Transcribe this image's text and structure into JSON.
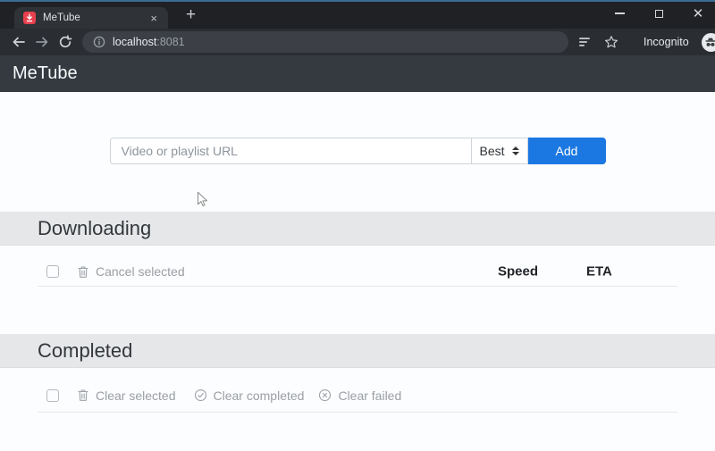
{
  "browser": {
    "tab_title": "MeTube",
    "close_glyph": "×",
    "new_tab_glyph": "+",
    "url": {
      "host": "localhost",
      "port": ":8081"
    },
    "incognito_label": "Incognito"
  },
  "navbar": {
    "brand": "MeTube"
  },
  "add_form": {
    "url_placeholder": "Video or playlist URL",
    "quality_value": "Best",
    "add_button": "Add"
  },
  "downloading_section": {
    "title": "Downloading",
    "cancel_selected_label": "Cancel selected",
    "speed_header": "Speed",
    "eta_header": "ETA"
  },
  "completed_section": {
    "title": "Completed",
    "clear_selected_label": "Clear selected",
    "clear_completed_label": "Clear completed",
    "clear_failed_label": "Clear failed"
  },
  "colors": {
    "accent_blue": "#1b78e2",
    "navbar_bg": "#343a40",
    "section_header_bg": "#e6e7e9",
    "muted_text": "#9a9ea3",
    "chrome_frame": "#1f2125",
    "chrome_toolbar": "#2a2d32",
    "omnibox_bg": "#3c4046",
    "favicon_red": "#e8404d"
  }
}
